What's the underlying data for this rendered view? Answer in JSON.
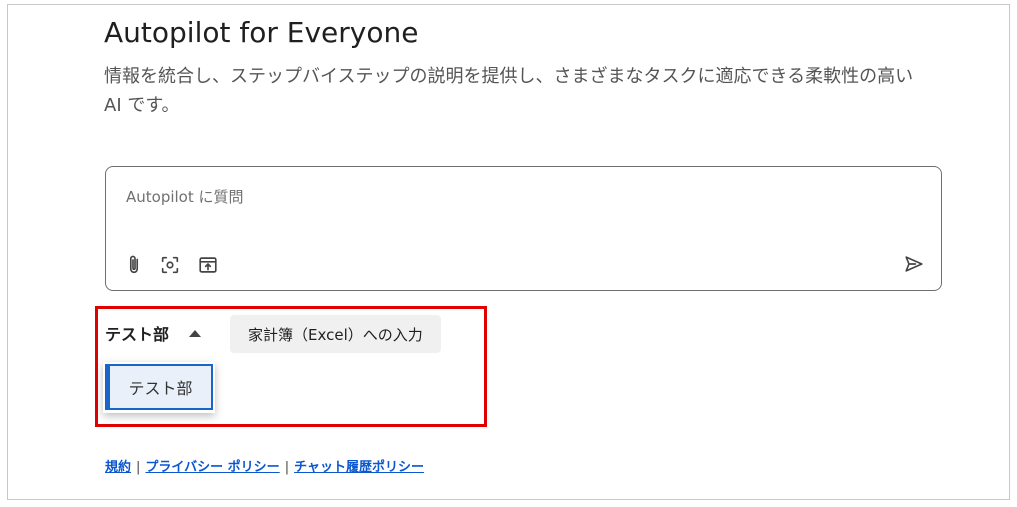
{
  "header": {
    "title": "Autopilot for Everyone",
    "description": "情報を統合し、ステップバイステップの説明を提供し、さまざまなタスクに適応できる柔軟性の高い AI です。"
  },
  "chat": {
    "placeholder": "Autopilot に質問",
    "tools": [
      "paperclip-icon",
      "screen-capture-icon",
      "upload-window-icon"
    ],
    "send_icon": "send-icon"
  },
  "department": {
    "selected": "テスト部",
    "options": [
      "テスト部"
    ]
  },
  "prompt_chip": {
    "label": "家計簿（Excel）への入力"
  },
  "footer": {
    "links": [
      "規約",
      "プライバシー ポリシー",
      "チャット履歴ポリシー"
    ],
    "separator": "|"
  },
  "colors": {
    "highlight": "#e00000",
    "link": "#0b57d0",
    "selected_option": "#1a66c8"
  }
}
